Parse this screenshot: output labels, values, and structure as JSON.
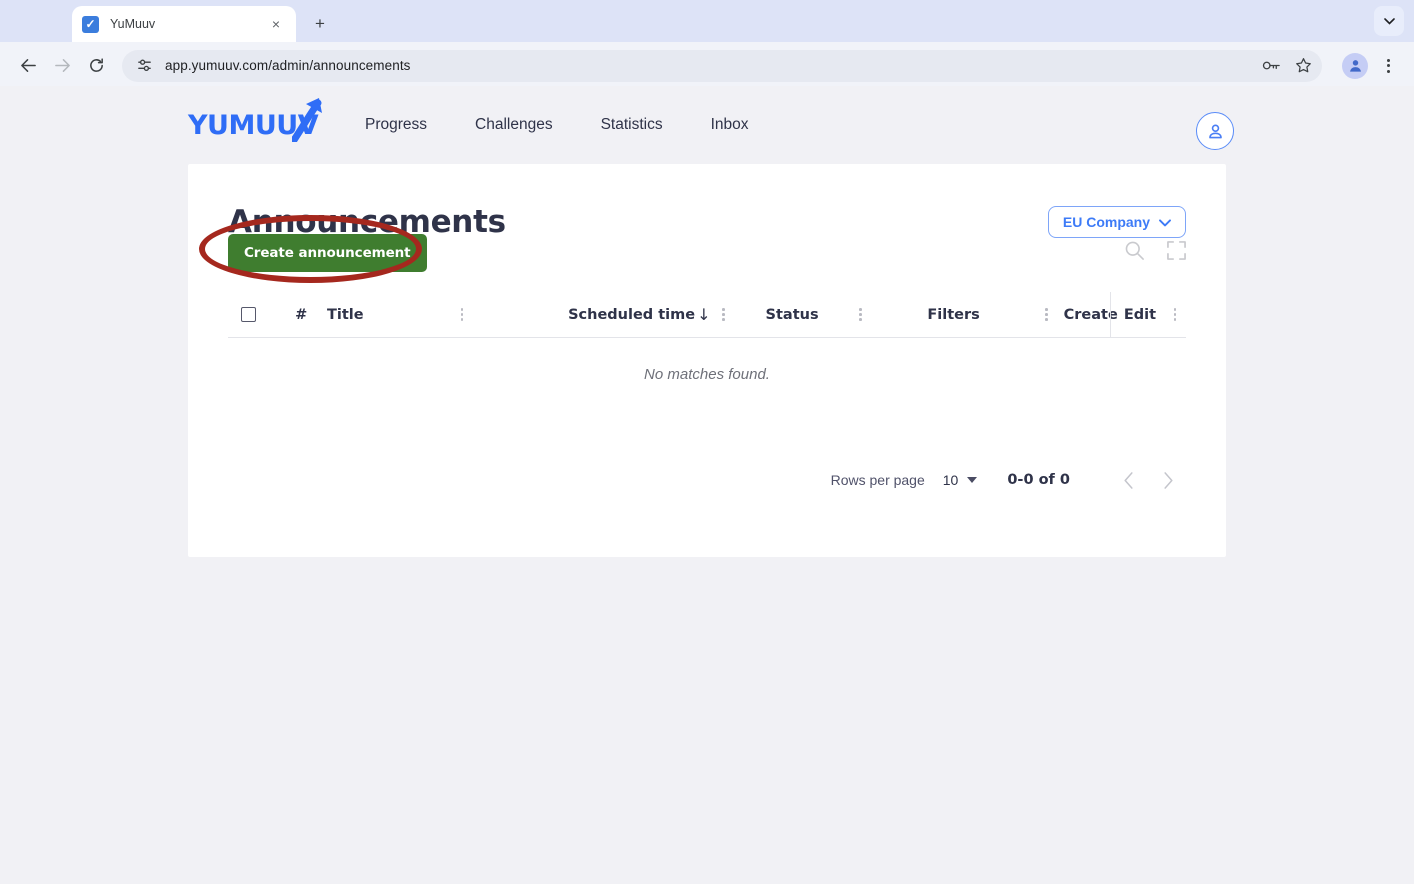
{
  "browser": {
    "tab": {
      "title": "YuMuuv",
      "favicon": "yumuuv-check-favicon",
      "close_label": "×"
    },
    "new_tab_label": "+",
    "tabstrip_chevron": "⌄",
    "back_label": "←",
    "forward_label": "→",
    "reload_label": "⟳",
    "url": "app.yumuuv.com/admin/announcements",
    "site_info_icon": "tune-icon",
    "password_icon": "key-icon",
    "bookmark_icon": "star-icon",
    "profile_icon": "person-icon",
    "menu_icon": "three-dot-menu-icon"
  },
  "app": {
    "logo_text": "YUMUUV",
    "nav": [
      {
        "label": "Progress"
      },
      {
        "label": "Challenges"
      },
      {
        "label": "Statistics"
      },
      {
        "label": "Inbox"
      }
    ],
    "avatar_icon": "user-avatar-icon"
  },
  "page": {
    "title": "Announcements",
    "company_selector": {
      "label": "EU Company",
      "chevron": "⌄"
    },
    "create_button": "Create announcement",
    "tools": {
      "search_icon": "search-icon",
      "fullscreen_icon": "fullscreen-icon"
    },
    "annotation": {
      "shape": "ellipse",
      "color": "#a5281e",
      "targets": "create-announcement-button"
    }
  },
  "table": {
    "columns": [
      {
        "key": "select",
        "label": ""
      },
      {
        "key": "num",
        "label": "#"
      },
      {
        "key": "title",
        "label": "Title"
      },
      {
        "key": "scheduled",
        "label": "Scheduled time",
        "sort": "↓"
      },
      {
        "key": "status",
        "label": "Status"
      },
      {
        "key": "filters",
        "label": "Filters"
      },
      {
        "key": "created",
        "label": "Create"
      },
      {
        "key": "edit",
        "label": "Edit"
      }
    ],
    "rows": [],
    "empty_message": "No matches found."
  },
  "pagination": {
    "rows_per_page_label": "Rows per page",
    "rows_per_page_value": "10",
    "range": "0-0 of 0",
    "prev_label": "‹",
    "next_label": "›"
  }
}
